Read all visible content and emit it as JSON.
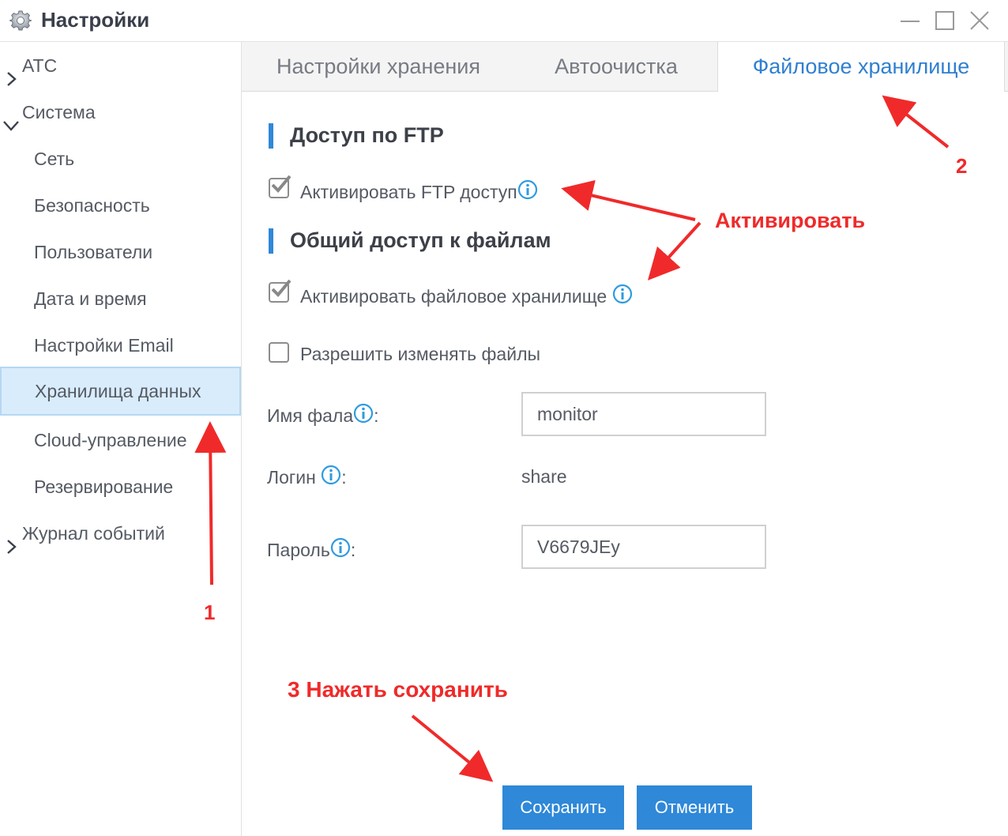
{
  "window": {
    "title": "Настройки",
    "icon": "gear-icon",
    "controls": [
      "minimize-icon",
      "maximize-icon",
      "close-icon"
    ]
  },
  "sidebar": {
    "items": [
      {
        "label": "АТС",
        "type": "group",
        "expanded": false
      },
      {
        "label": "Система",
        "type": "group",
        "expanded": true
      },
      {
        "label": "Сеть",
        "type": "child"
      },
      {
        "label": "Безопасность",
        "type": "child"
      },
      {
        "label": "Пользователи",
        "type": "child"
      },
      {
        "label": "Дата и время",
        "type": "child"
      },
      {
        "label": "Настройки Email",
        "type": "child"
      },
      {
        "label": "Хранилища данных",
        "type": "child",
        "selected": true
      },
      {
        "label": "Cloud-управление",
        "type": "child"
      },
      {
        "label": "Резервирование",
        "type": "child"
      },
      {
        "label": "Журнал событий",
        "type": "group",
        "expanded": false
      }
    ]
  },
  "tabs": [
    {
      "label": "Настройки хранения",
      "active": false
    },
    {
      "label": "Автоочистка",
      "active": false
    },
    {
      "label": "Файловое хранилище",
      "active": true
    }
  ],
  "content": {
    "ftp_section_title": "Доступ по FTP",
    "ftp_enable": {
      "label": "Активировать FTP доступ",
      "checked": true
    },
    "share_section_title": "Общий доступ к файлам",
    "share_enable": {
      "label": "Активировать файловое хранилище",
      "checked": true
    },
    "allow_modify": {
      "label": "Разрешить изменять файлы",
      "checked": false
    },
    "share_name": {
      "label": "Имя фала",
      "value": "monitor"
    },
    "login": {
      "label": "Логин",
      "value": "share"
    },
    "password": {
      "label": "Пароль",
      "value": "V6679JEy"
    },
    "colon": ":"
  },
  "buttons": {
    "save": "Сохранить",
    "cancel": "Отменить"
  },
  "annotations": {
    "step1": "1",
    "step2": "2",
    "activate": "Активировать",
    "step3": "3 Нажать сохранить"
  },
  "colors": {
    "accent": "#2f88d8",
    "annotation": "#f02a2a",
    "selected_bg": "#d9ecfb"
  }
}
